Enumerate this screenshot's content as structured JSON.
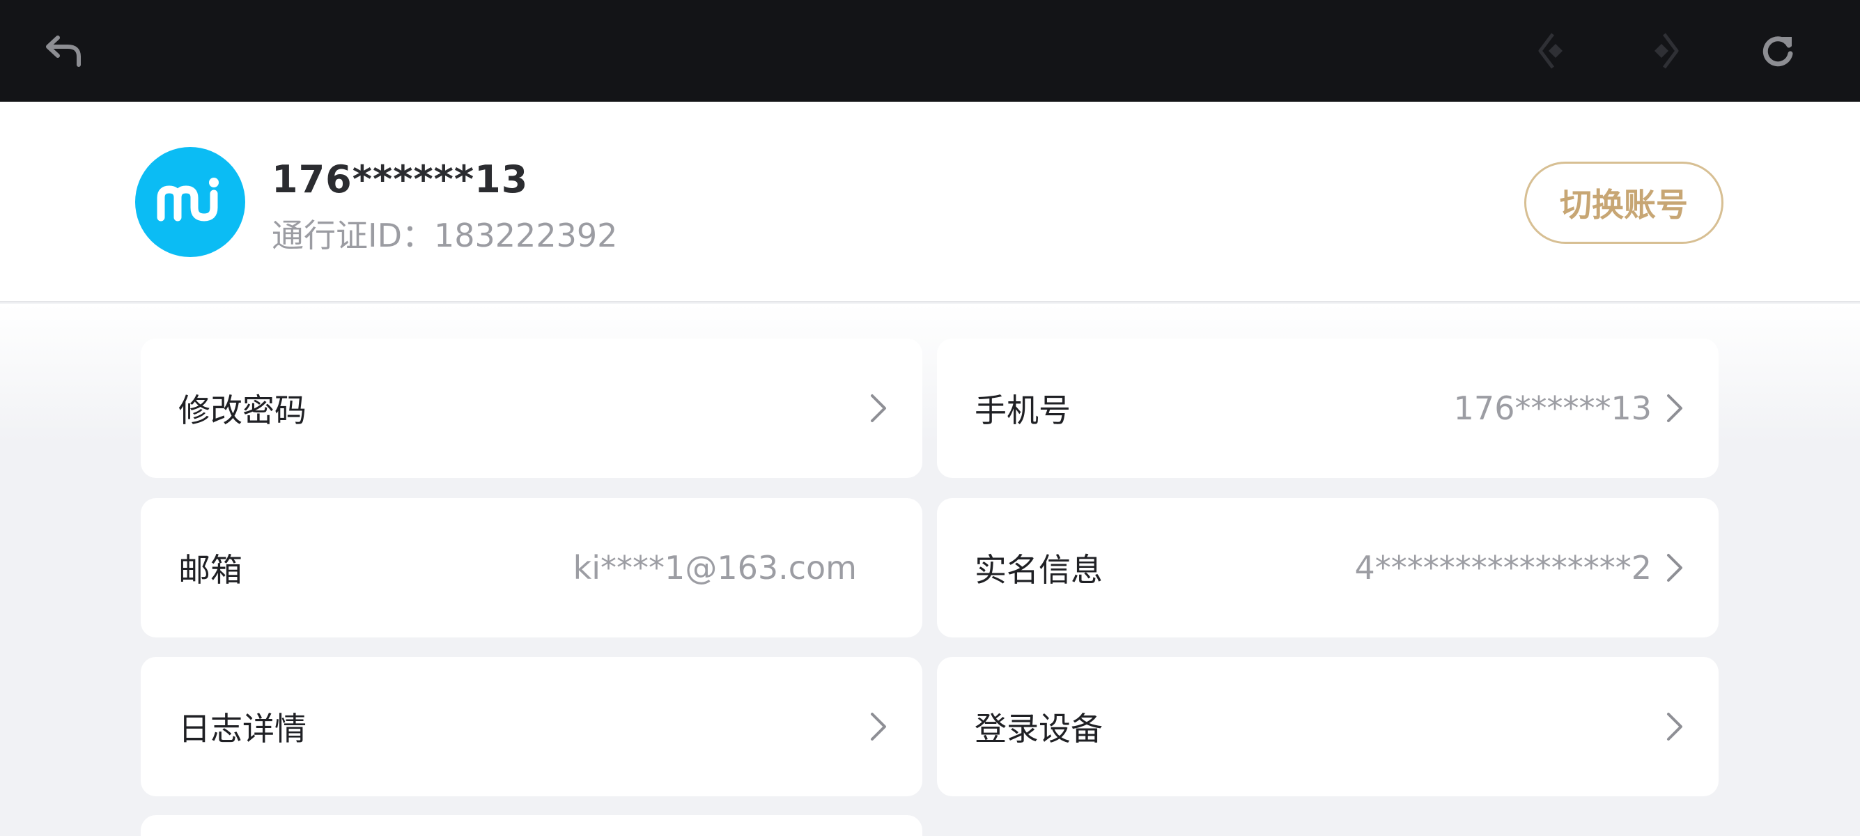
{
  "topbar": {
    "icons": {
      "back": "undo-arrow-icon",
      "prev": "prev-diamond-arrow-icon",
      "next": "next-diamond-arrow-icon",
      "refresh": "refresh-icon"
    }
  },
  "account": {
    "avatar_icon": "mi-logo-icon",
    "phone": "176******13",
    "id_line": "通行证ID：183222392",
    "switch_label": "切换账号"
  },
  "settings": [
    {
      "label": "修改密码",
      "value": "",
      "arrow": true
    },
    {
      "label": "手机号",
      "value": "176******13",
      "arrow": true
    },
    {
      "label": "邮箱",
      "value": "ki****1@163.com",
      "arrow": false
    },
    {
      "label": "实名信息",
      "value": "4****************2",
      "arrow": true
    },
    {
      "label": "日志详情",
      "value": "",
      "arrow": true
    },
    {
      "label": "登录设备",
      "value": "",
      "arrow": true
    }
  ],
  "colors": {
    "topbar_bg": "#131417",
    "avatar_bg": "#0bbcf4",
    "switch_accent": "#c7a674",
    "page_bg": "#f1f2f5"
  }
}
